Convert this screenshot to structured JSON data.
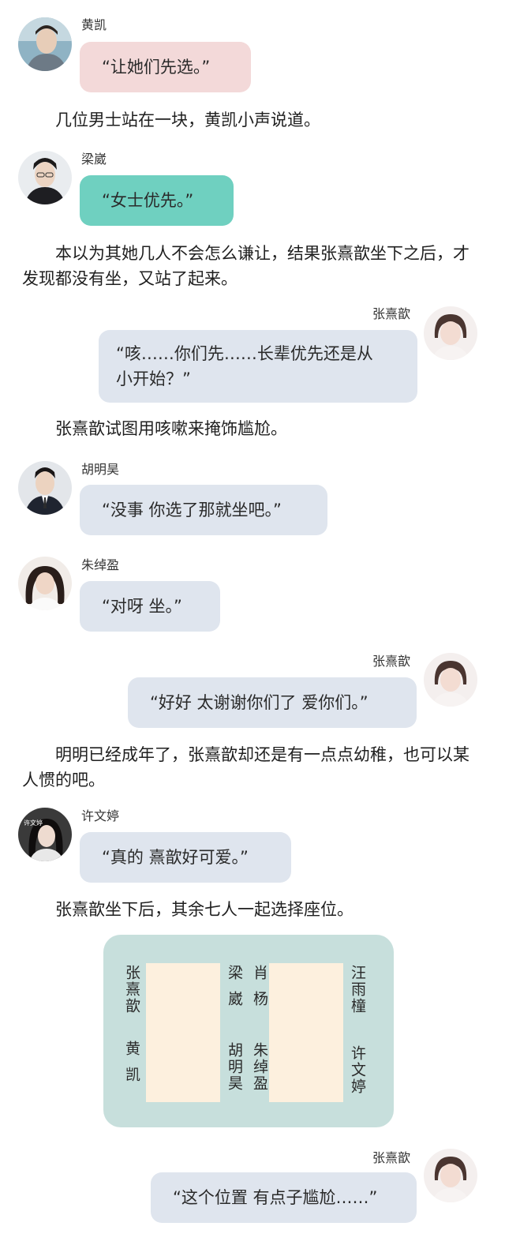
{
  "chat": {
    "m1": {
      "speaker": "黄凯",
      "text": "“让她们先选。”"
    },
    "n1": "几位男士站在一块，黄凯小声说道。",
    "m2": {
      "speaker": "梁崴",
      "text": "“女士优先。”"
    },
    "n2": "本以为其她几人不会怎么谦让，结果张熹歆坐下之后，才发现都没有坐，又站了起来。",
    "m3": {
      "speaker": "张熹歆",
      "line1": "“咳……你们先……长辈优先还是从",
      "line2": "小开始？”"
    },
    "n3": "张熹歆试图用咳嗽来掩饰尴尬。",
    "m4": {
      "speaker": "胡明昊",
      "text": "“没事 你选了那就坐吧。”"
    },
    "m5": {
      "speaker": "朱绰盈",
      "text": "“对呀 坐。”"
    },
    "m6": {
      "speaker": "张熹歆",
      "text": "“好好 太谢谢你们了 爱你们。”"
    },
    "n4": "明明已经成年了，张熹歆却还是有一点点幼稚，也可以某人惯的吧。",
    "m7": {
      "speaker": "许文婷",
      "text": "“真的 熹歆好可爱。”"
    },
    "n5": "张熹歆坐下后，其余七人一起选择座位。",
    "m8": {
      "speaker": "张熹歆",
      "text": "“这个位置 有点子尴尬……”"
    }
  },
  "seating": {
    "left_top": "张熹歆",
    "left_bottom": "黄凯",
    "mid_left_top": "梁崴",
    "mid_left_bottom": "胡明昊",
    "mid_right_top": "肖杨",
    "mid_right_bottom": "朱绰盈",
    "right_top": "汪雨橦",
    "right_bottom": "许文婷"
  },
  "avatar_watermarks": {
    "xu": "许文婷"
  },
  "colors": {
    "bubble_blue": "#dfe5ee",
    "bubble_pink": "#f3d9d9",
    "bubble_teal": "#6fd0c0",
    "diagram_bg": "#c7dfdc",
    "table_fill": "#fdf0de"
  }
}
